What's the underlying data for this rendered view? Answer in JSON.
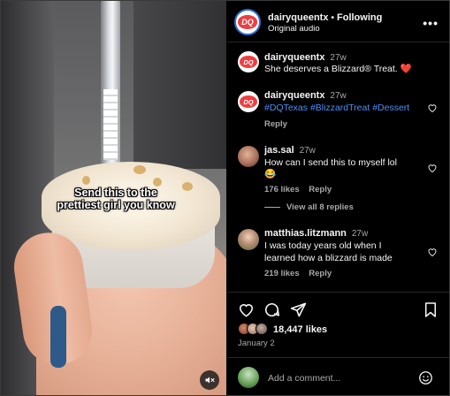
{
  "header": {
    "username": "dairyqueentx",
    "separator": "•",
    "follow_status": "Following",
    "audio": "Original audio",
    "more_icon": "more-horizontal-icon"
  },
  "video": {
    "overlay_caption": "Send this to the prettiest girl you know",
    "mute_icon": "speaker-muted-icon"
  },
  "caption": {
    "username": "dairyqueentx",
    "time": "27w",
    "text": "She deserves a Blizzard® Treat. ❤️"
  },
  "comments": [
    {
      "username": "dairyqueentx",
      "time": "27w",
      "hashtags": [
        "#DQTexas",
        "#BlizzardTreat",
        "#Dessert"
      ],
      "reply_label": "Reply"
    },
    {
      "username": "jas.sal",
      "time": "27w",
      "text_line1": "How can I send this to myself lol",
      "text_line2": "😂",
      "likes": "176 likes",
      "reply_label": "Reply",
      "view_replies": "View all 8 replies"
    },
    {
      "username": "matthias.litzmann",
      "time": "27w",
      "text_line1": "I was today years old when I",
      "text_line2": "learned how a blizzard is made",
      "likes": "219 likes",
      "reply_label": "Reply"
    }
  ],
  "actions": {
    "like_icon": "heart-icon",
    "comment_icon": "comment-icon",
    "share_icon": "share-icon",
    "save_icon": "bookmark-icon"
  },
  "stats": {
    "likes": "18,447 likes",
    "date": "January 2"
  },
  "add_comment": {
    "placeholder": "Add a comment...",
    "emoji_icon": "smiley-icon"
  },
  "colors": {
    "background": "#000000",
    "text": "#f5f5f5",
    "muted": "#a8a8a8",
    "link": "#4d8ef7",
    "dq_red": "#ee3e42",
    "divider": "#262626"
  }
}
